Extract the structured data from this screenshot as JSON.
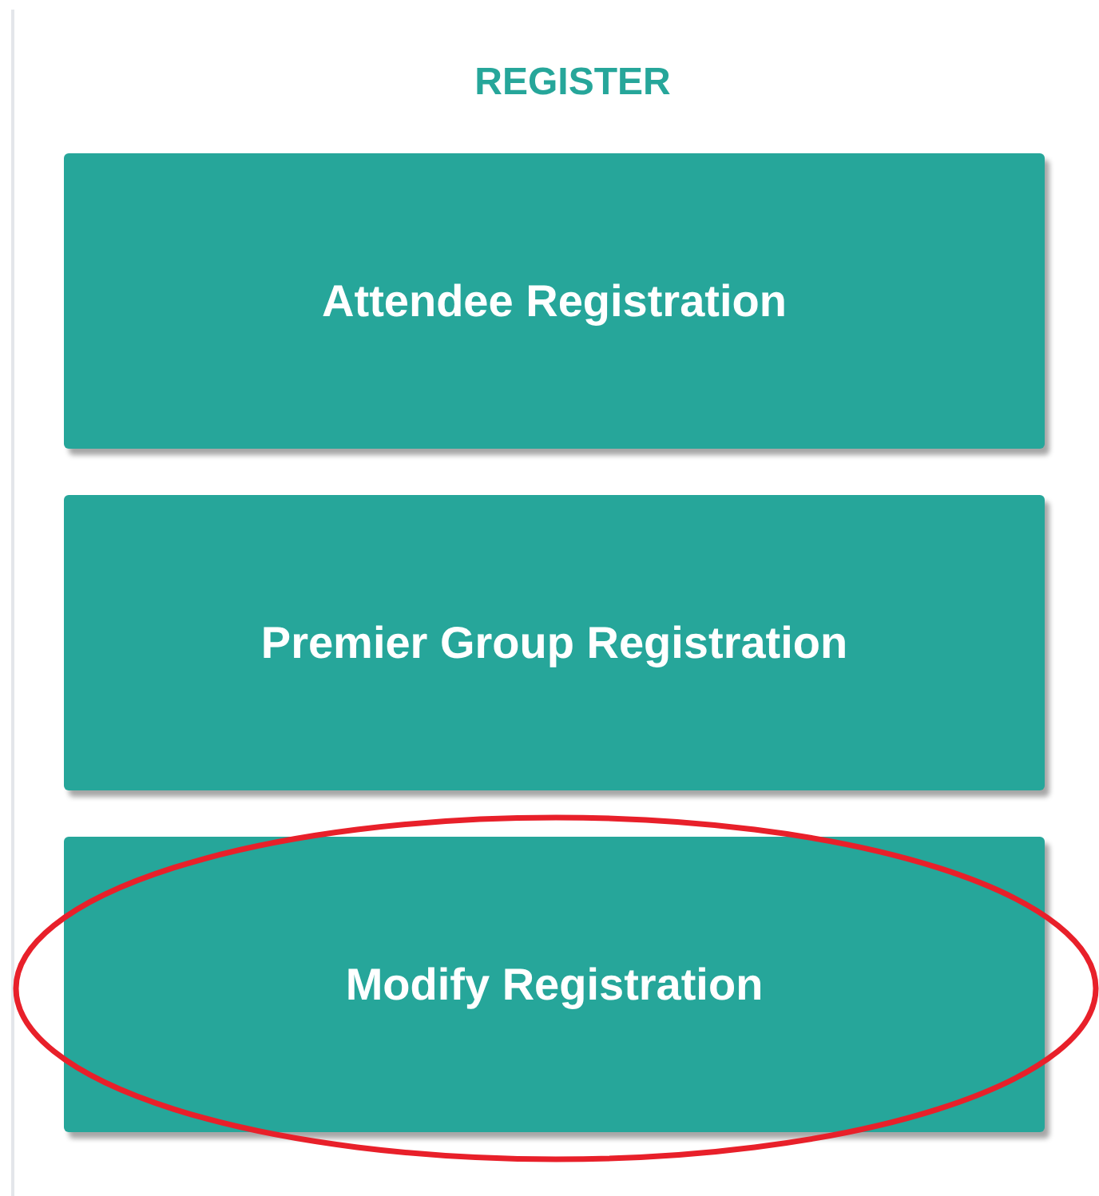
{
  "heading": "REGISTER",
  "buttons": [
    {
      "label": "Attendee Registration",
      "circled": false
    },
    {
      "label": "Premier Group Registration",
      "circled": false
    },
    {
      "label": "Modify Registration",
      "circled": true
    }
  ]
}
